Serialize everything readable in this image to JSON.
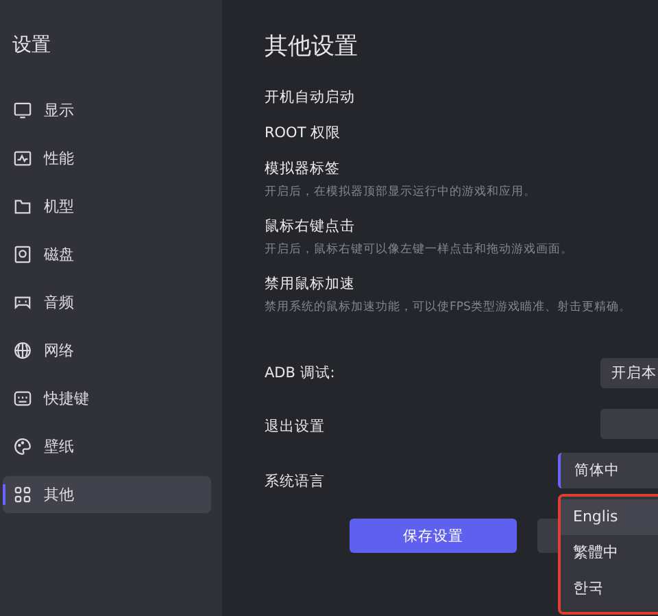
{
  "sidebar": {
    "title": "设置",
    "items": [
      {
        "label": "显示",
        "selected": false
      },
      {
        "label": "性能",
        "selected": false
      },
      {
        "label": "机型",
        "selected": false
      },
      {
        "label": "磁盘",
        "selected": false
      },
      {
        "label": "音频",
        "selected": false
      },
      {
        "label": "网络",
        "selected": false
      },
      {
        "label": "快捷键",
        "selected": false
      },
      {
        "label": "壁纸",
        "selected": false
      },
      {
        "label": "其他",
        "selected": true
      }
    ]
  },
  "main": {
    "title": "其他设置",
    "settings": [
      {
        "label": "开机自动启动"
      },
      {
        "label": "ROOT 权限"
      },
      {
        "label": "模拟器标签",
        "description": "开启后，在模拟器顶部显示运行中的游戏和应用。"
      },
      {
        "label": "鼠标右键点击",
        "description": "开启后，鼠标右键可以像左键一样点击和拖动游戏画面。"
      },
      {
        "label": "禁用鼠标加速",
        "description": "禁用系统的鼠标加速功能，可以使FPS类型游戏瞄准、射击更精确。"
      }
    ],
    "adb": {
      "label": "ADB 调试:",
      "value": "开启本"
    },
    "exit": {
      "label": "退出设置"
    },
    "language": {
      "label": "系统语言",
      "value": "简体中",
      "options": [
        {
          "label": "Englis",
          "selected": true
        },
        {
          "label": "繁體中",
          "selected": false
        },
        {
          "label": "한국",
          "selected": false
        }
      ]
    },
    "buttons": [
      {
        "kind": "primary",
        "label": "保存设置"
      },
      {
        "kind": "secondary"
      }
    ]
  }
}
